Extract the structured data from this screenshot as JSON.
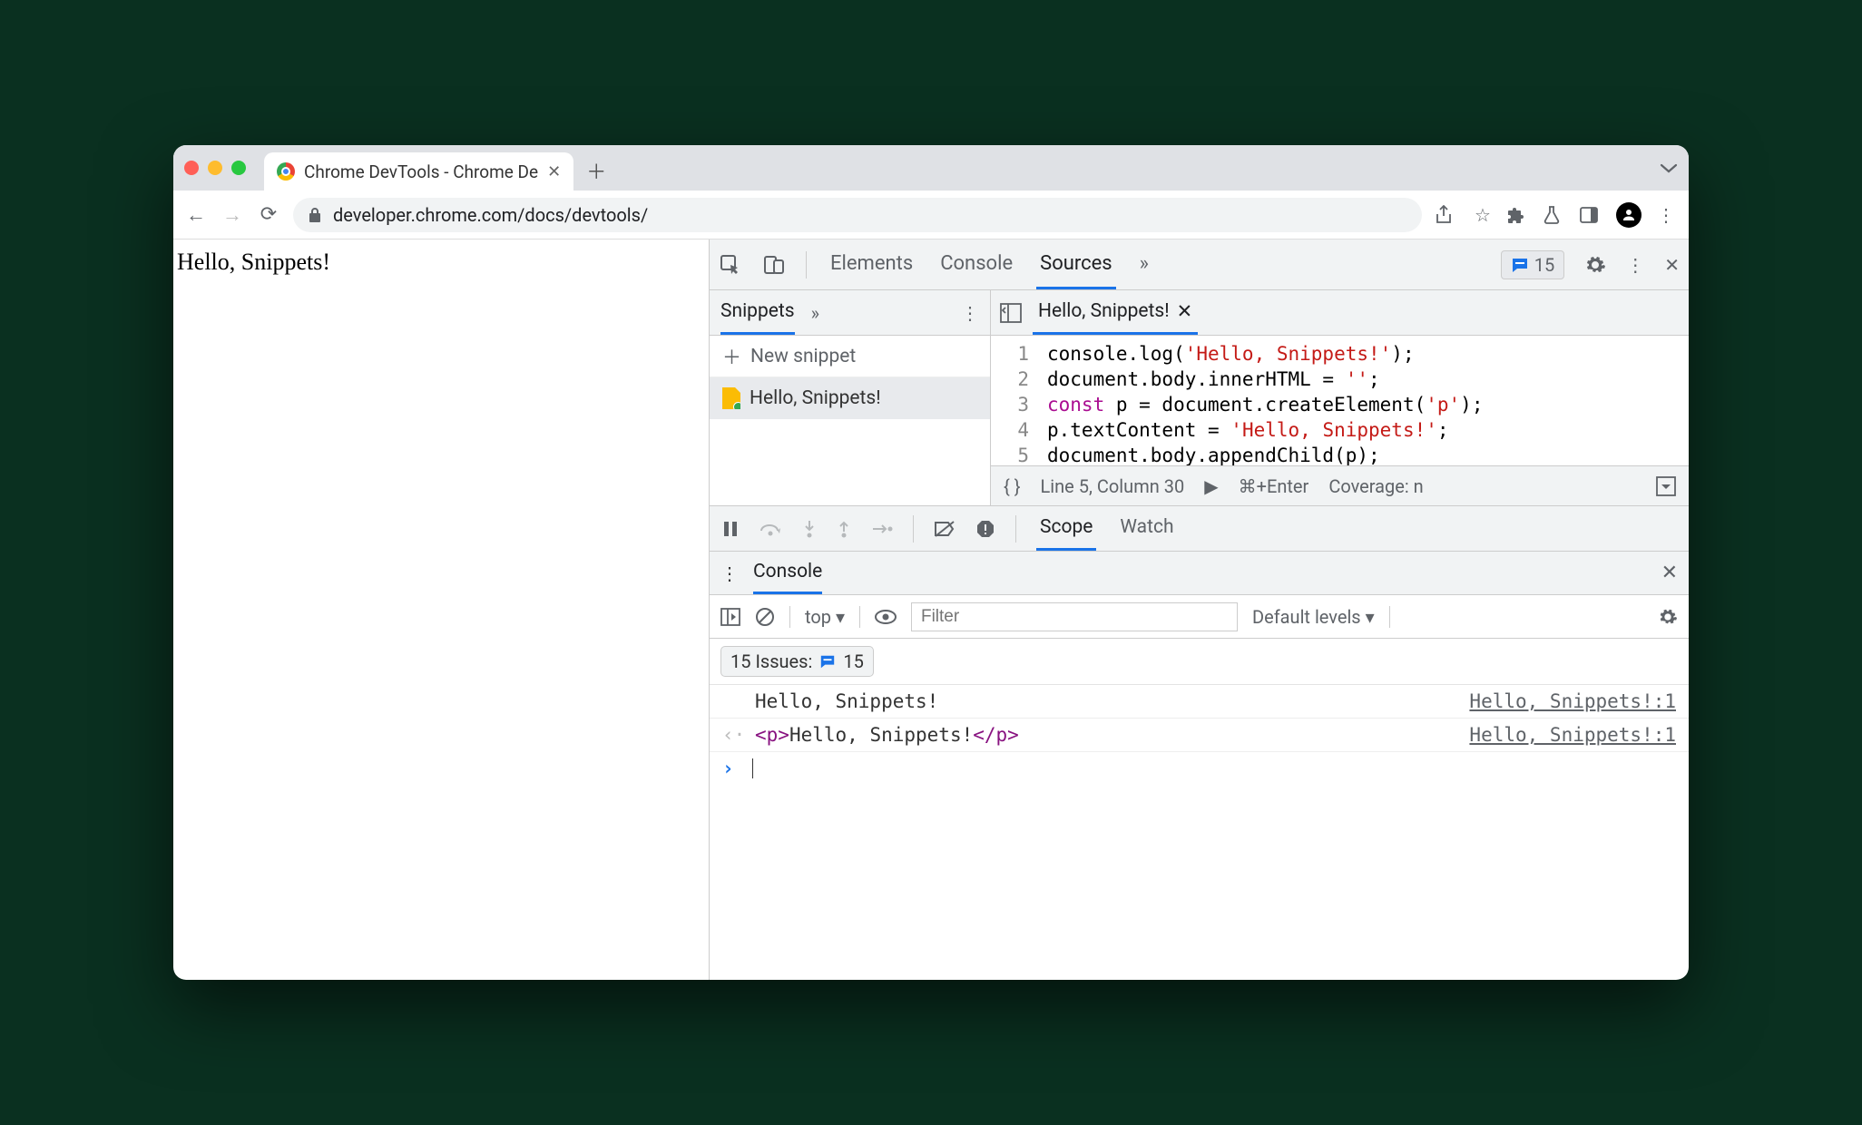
{
  "browser": {
    "tab_title": "Chrome DevTools - Chrome De",
    "url": "developer.chrome.com/docs/devtools/"
  },
  "page": {
    "content": "Hello, Snippets!"
  },
  "devtools": {
    "tabs": {
      "elements": "Elements",
      "console": "Console",
      "sources": "Sources"
    },
    "issues_count": "15",
    "snippets": {
      "tab": "Snippets",
      "new": "New snippet",
      "item": "Hello, Snippets!"
    },
    "editor": {
      "tab": "Hello, Snippets!",
      "lines": [
        "console.log('Hello, Snippets!');",
        "document.body.innerHTML = '';",
        "const p = document.createElement('p');",
        "p.textContent = 'Hello, Snippets!';",
        "document.body.appendChild(p);"
      ],
      "status_line": "Line 5, Column 30",
      "run_hint": "⌘+Enter",
      "coverage": "Coverage: n"
    },
    "debugger": {
      "scope": "Scope",
      "watch": "Watch"
    },
    "drawer": {
      "tab": "Console",
      "context": "top",
      "filter_placeholder": "Filter",
      "levels": "Default levels",
      "issues_label": "15 Issues:",
      "issues_count": "15",
      "rows": [
        {
          "text": "Hello, Snippets!",
          "source": "Hello, Snippets!:1"
        },
        {
          "html_open": "<p>",
          "html_text": "Hello, Snippets!",
          "html_close": "</p>",
          "source": "Hello, Snippets!:1"
        }
      ]
    }
  }
}
